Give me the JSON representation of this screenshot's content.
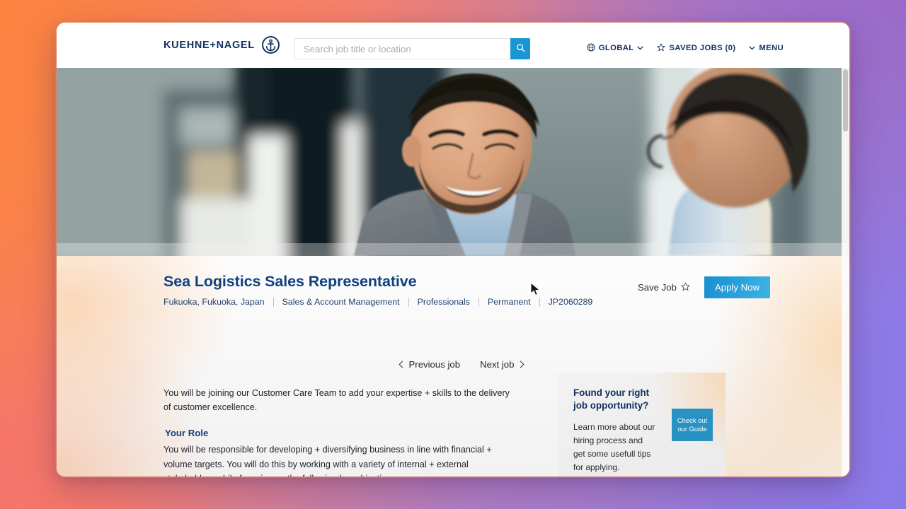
{
  "header": {
    "brand_name": "KUEHNE+NAGEL",
    "brand_mark_icon": "anchor-in-circle-icon",
    "search": {
      "placeholder": "Search job title or location",
      "value": "",
      "submit_icon": "search-icon"
    },
    "nav": [
      {
        "label": "GLOBAL",
        "icon": "globe-icon",
        "trailing_icon": "chevron-down-icon"
      },
      {
        "label": "SAVED JOBS (0)",
        "icon": "star-outline-icon"
      },
      {
        "label": "MENU",
        "icon": "chevron-down-icon"
      }
    ]
  },
  "hero": {
    "alt": "Two businessmen smiling during a conversation in an office"
  },
  "job": {
    "title": "Sea Logistics Sales Representative",
    "meta": [
      "Fukuoka, Fukuoka, Japan",
      "Sales & Account Management",
      "Professionals",
      "Permanent",
      "JP2060289"
    ],
    "save_label": "Save Job",
    "save_icon": "star-outline-icon",
    "apply_label": "Apply Now",
    "pager": {
      "previous_label": "Previous job",
      "next_label": "Next job",
      "previous_icon": "chevron-left-icon",
      "next_icon": "chevron-right-icon"
    },
    "intro": "You will be joining our Customer Care Team to add your expertise + skills to the delivery of customer excellence.",
    "role_heading": "Your Role",
    "role_paragraph": "You will be responsible for developing + diversifying business in line with financial + volume targets. You will do this by working with a variety of internal + external stakeholders while focusing on the following key objectives:"
  },
  "guide_card": {
    "title": "Found your right job opportunity?",
    "text": "Learn more about our hiring process and get some usefull tips for applying.",
    "cta_label": "Check out our Guide"
  },
  "colors": {
    "brand_navy": "#11305e",
    "title_blue": "#11407f",
    "accent_blue": "#1b96d4",
    "cta_blue": "#2892c2",
    "backdrop_orange": "#fa8142",
    "backdrop_purple": "#9a6ac9"
  }
}
